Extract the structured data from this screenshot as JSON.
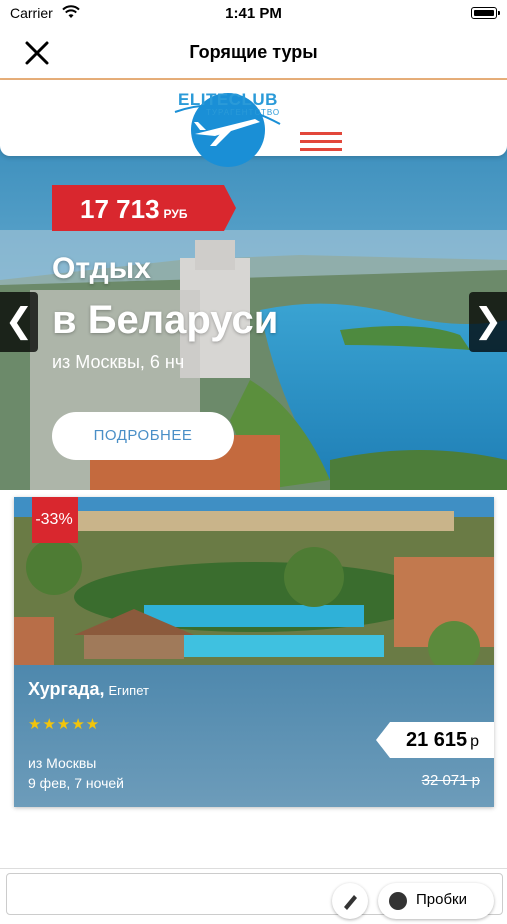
{
  "status_bar": {
    "carrier": "Carrier",
    "time": "1:41 PM"
  },
  "nav": {
    "title": "Горящие туры"
  },
  "logo": {
    "text": "ELITECLUB",
    "subtext": "ТУРАГЕНТСТВО"
  },
  "hero": {
    "price": "17 713",
    "currency": "РУБ",
    "title_line1": "Отдых",
    "title_line2": "в Беларуси",
    "subtitle": "из Москвы, 6 нч",
    "button": "ПОДРОБНЕЕ",
    "prev_arrow": "❮",
    "next_arrow": "❯"
  },
  "tour_card": {
    "discount": "-33%",
    "city": "Хургада,",
    "country": "Египет",
    "stars": "★★★★★",
    "rating": 5,
    "origin": "из Москвы",
    "dates": "9 фев, 7 ночей",
    "price": "21 615",
    "price_currency": "р",
    "old_price": "32 071 р"
  },
  "bottom_bar": {
    "chat_label": "Пробки"
  },
  "colors": {
    "accent_red": "#d9272e",
    "brand_blue": "#2a9ad8",
    "card_blue": "#5c8fb0",
    "star_yellow": "#f2c40b"
  }
}
